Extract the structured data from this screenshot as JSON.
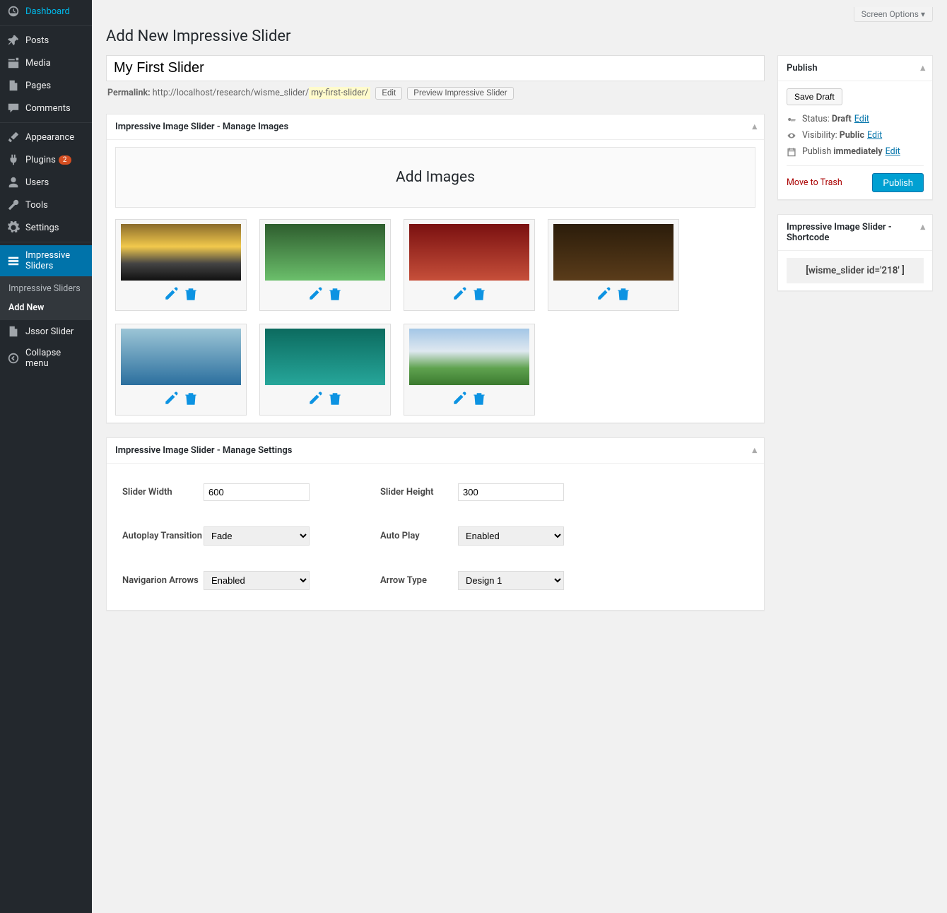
{
  "screenOptions": "Screen Options",
  "pageTitle": "Add New Impressive Slider",
  "titleValue": "My First Slider",
  "permalink": {
    "label": "Permalink:",
    "base": "http://localhost/research/wisme_slider/",
    "slug": "my-first-slider/",
    "editBtn": "Edit",
    "previewBtn": "Preview Impressive Slider"
  },
  "sidebar": [
    {
      "icon": "dashboard",
      "label": "Dashboard"
    },
    {
      "sep": true
    },
    {
      "icon": "pin",
      "label": "Posts"
    },
    {
      "icon": "media",
      "label": "Media"
    },
    {
      "icon": "page",
      "label": "Pages"
    },
    {
      "icon": "comment",
      "label": "Comments"
    },
    {
      "sep": true
    },
    {
      "icon": "brush",
      "label": "Appearance"
    },
    {
      "icon": "plug",
      "label": "Plugins",
      "badge": "2"
    },
    {
      "icon": "user",
      "label": "Users"
    },
    {
      "icon": "wrench",
      "label": "Tools"
    },
    {
      "icon": "gear",
      "label": "Settings"
    },
    {
      "sep": true
    },
    {
      "icon": "sliders",
      "label": "Impressive Sliders",
      "active": true,
      "submenu": [
        {
          "label": "Impressive Sliders"
        },
        {
          "label": "Add New",
          "current": true
        }
      ]
    },
    {
      "icon": "page",
      "label": "Jssor Slider"
    },
    {
      "icon": "collapse",
      "label": "Collapse menu"
    }
  ],
  "manageImages": {
    "title": "Impressive Image Slider - Manage Images",
    "addBtn": "Add Images",
    "thumbs": [
      "sunset",
      "forest",
      "temple",
      "night",
      "water1",
      "water2",
      "mountain"
    ]
  },
  "manageSettings": {
    "title": "Impressive Image Slider - Manage Settings",
    "rows": [
      {
        "l1": "Slider Width",
        "t1": "input",
        "v1": "600",
        "l2": "Slider Height",
        "t2": "input",
        "v2": "300"
      },
      {
        "l1": "Autoplay Transition",
        "t1": "select",
        "v1": "Fade",
        "l2": "Auto Play",
        "t2": "select",
        "v2": "Enabled"
      },
      {
        "l1": "Navigarion Arrows",
        "t1": "select",
        "v1": "Enabled",
        "l2": "Arrow Type",
        "t2": "select",
        "v2": "Design 1"
      }
    ]
  },
  "publish": {
    "title": "Publish",
    "saveDraft": "Save Draft",
    "statusLabel": "Status:",
    "statusValue": "Draft",
    "statusEdit": "Edit",
    "visibilityLabel": "Visibility:",
    "visibilityValue": "Public",
    "visibilityEdit": "Edit",
    "publishLabel": "Publish",
    "publishValue": "immediately",
    "publishEdit": "Edit",
    "trash": "Move to Trash",
    "publishBtn": "Publish"
  },
  "shortcode": {
    "title": "Impressive Image Slider - Shortcode",
    "code": "[wisme_slider id='218' ]"
  }
}
